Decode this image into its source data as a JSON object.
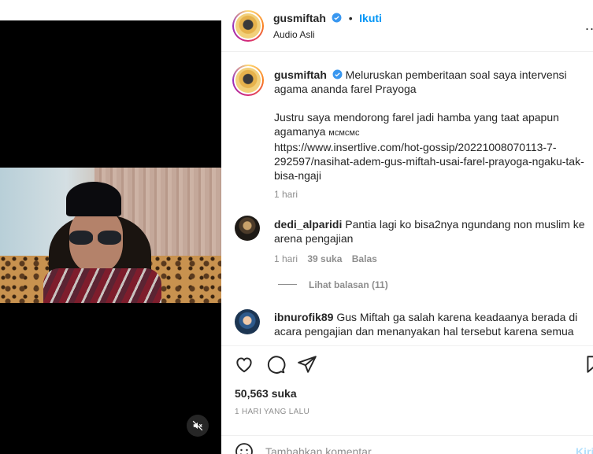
{
  "post": {
    "username": "gusmiftah",
    "follow_label": "Ikuti",
    "dot": "•",
    "audio": "Audio Asli",
    "more": "...",
    "caption_line1": "Meluruskan pemberitaan soal saya intervensi",
    "caption_line2": "agama ananda farel Prayoga",
    "caption_p2_line1": "Justru saya mendorong farel jadi hamba yang taat apapun",
    "caption_p2_line2": "agamanya",
    "caption_suffix": "ᴍᴄᴍᴄᴍᴄ",
    "link_line1": "https://www.insertlive.com/hot-gossip/20221008070113-7-",
    "link_line2": "292597/nasihat-adem-gus-miftah-usai-farel-prayoga-ngaku-tak-",
    "link_line3": "bisa-ngaji",
    "caption_time": "1 hari"
  },
  "comments": [
    {
      "username": "dedi_alparidi",
      "text_line1": "Pantia lagi ko bisa2nya ngundang non muslim ke",
      "text_line2": "arena pengajian",
      "time": "1 hari",
      "likes": "39 suka",
      "reply": "Balas",
      "view_replies": "Lihat balasan (11)"
    },
    {
      "username": "ibnurofik89",
      "text_line1": "Gus Miftah ga salah karena keadaanya berada di",
      "text_line2": "acara pengajian dan menanyakan hal tersebut karena semua"
    }
  ],
  "footer": {
    "likes": "50,563 suka",
    "date": "1 HARI YANG LALU",
    "comment_placeholder": "Tambahkan komentar...",
    "post_label": "Kirim"
  },
  "colors": {
    "accent": "#0095f6",
    "verified": "#3897f0",
    "muted": "#8e8e8e"
  },
  "icons": [
    "heart-icon",
    "comment-icon",
    "share-icon",
    "bookmark-icon",
    "emoji-icon",
    "mute-icon",
    "verified-icon"
  ]
}
